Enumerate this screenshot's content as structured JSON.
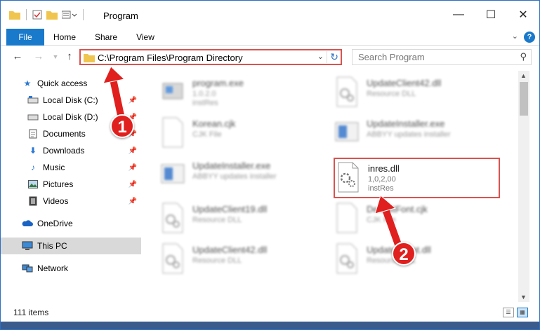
{
  "window": {
    "title": "Program",
    "controls": {
      "minimize": "—",
      "maximize": "☐",
      "close": "✕"
    }
  },
  "ribbon": {
    "tabs": [
      "File",
      "Home",
      "Share",
      "View"
    ],
    "help": "?"
  },
  "address": {
    "path": "C:\\Program Files\\Program Directory",
    "search_placeholder": "Search Program"
  },
  "nav": {
    "items": [
      {
        "label": "Quick access",
        "icon": "star-icon"
      },
      {
        "label": "Local Disk (C:)",
        "icon": "drive-icon",
        "pinned": true
      },
      {
        "label": "Local Disk (D:)",
        "icon": "drive-icon",
        "pinned": true
      },
      {
        "label": "Documents",
        "icon": "documents-icon",
        "pinned": true
      },
      {
        "label": "Downloads",
        "icon": "download-icon",
        "pinned": true
      },
      {
        "label": "Music",
        "icon": "music-icon",
        "pinned": true
      },
      {
        "label": "Pictures",
        "icon": "pictures-icon",
        "pinned": true
      },
      {
        "label": "Videos",
        "icon": "videos-icon",
        "pinned": true
      },
      {
        "label": "OneDrive",
        "icon": "cloud-icon"
      },
      {
        "label": "This PC",
        "icon": "computer-icon",
        "selected": true
      },
      {
        "label": "Network",
        "icon": "network-icon"
      }
    ]
  },
  "files": [
    {
      "name": "program.exe",
      "sub1": "1.0.2.0",
      "sub2": "instRes",
      "kind": "exe",
      "blurred": true
    },
    {
      "name": "UpdateClient42.dll",
      "sub1": "Resource DLL",
      "sub2": "",
      "kind": "dll",
      "blurred": true
    },
    {
      "name": "Korean.cjk",
      "sub1": "CJK File",
      "sub2": "",
      "kind": "doc",
      "blurred": true
    },
    {
      "name": "UpdateInstaller.exe",
      "sub1": "ABBYY updates installer",
      "sub2": "",
      "kind": "app",
      "blurred": true
    },
    {
      "name": "UpdateInstaller.exe",
      "sub1": "ABBYY updates installer",
      "sub2": "",
      "kind": "app",
      "blurred": true
    },
    {
      "name": "inres.dll",
      "sub1": "1,0,2,00",
      "sub2": "instRes",
      "kind": "dll",
      "blurred": false
    },
    {
      "name": "UpdateClient19.dll",
      "sub1": "Resource DLL",
      "sub2": "",
      "kind": "dll",
      "blurred": true
    },
    {
      "name": "DefaultFont.cjk",
      "sub1": "CJK File",
      "sub2": "",
      "kind": "doc",
      "blurred": true
    },
    {
      "name": "UpdateClient42.dll",
      "sub1": "Resource DLL",
      "sub2": "",
      "kind": "dll",
      "blurred": true
    },
    {
      "name": "UpdateClient.dll",
      "sub1": "Resource DLL",
      "sub2": "",
      "kind": "dll",
      "blurred": true
    }
  ],
  "status": {
    "count": "111 items"
  },
  "callouts": [
    "1",
    "2"
  ]
}
